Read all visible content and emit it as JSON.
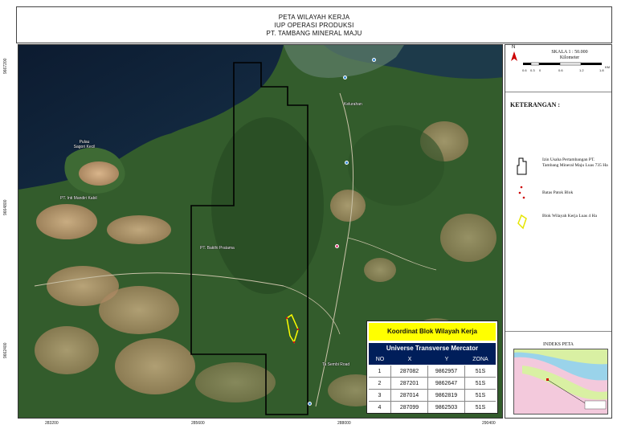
{
  "title": {
    "line1": "PETA WILAYAH KERJA",
    "line2": "IUP OPERASI PRODUKSI",
    "line3": "PT. TAMBANG MINERAL MAJU"
  },
  "axes": {
    "y_ticks": [
      "9667200",
      "9664800",
      "9662400"
    ],
    "x_ticks": [
      "283200",
      "285600",
      "288000",
      "290400"
    ]
  },
  "map_labels": {
    "pulau_sagori": "Pulau\nSagori Kecil",
    "pt_inti_mandiri": "PT. Inti Mandiri Kabil",
    "pt_bakti": "PT. Bakthi Pratama",
    "kelurahan": "Kelurahan",
    "ta_sembi": "Ta Sembi Road"
  },
  "scale": {
    "text": "SKALA 1 : 50.000",
    "unit": "Kilometer",
    "north": "N",
    "numbers": [
      "0.6",
      "0.3",
      "0",
      "0.6",
      "1.2",
      "1.8"
    ],
    "km": "KM"
  },
  "legend": {
    "title": "KETERANGAN :",
    "items": [
      {
        "label": "Izin Usaha Pertambangan PT. Tambang Mineral Maju Luas 735 Ha"
      },
      {
        "label": "Batas Patok Blok"
      },
      {
        "label": "Blok Wilayah Kerja Luas 4 Ha"
      }
    ]
  },
  "index_map": {
    "title": "INDEKS PETA"
  },
  "coord_table": {
    "title": "Koordinat Blok Wilayah Kerja",
    "subtitle": "Universe Transverse Mercator",
    "headers": [
      "NO",
      "X",
      "Y",
      "ZONA"
    ],
    "rows": [
      [
        "1",
        "287082",
        "9862957",
        "51S"
      ],
      [
        "2",
        "287201",
        "9862647",
        "51S"
      ],
      [
        "3",
        "287014",
        "9862819",
        "51S"
      ],
      [
        "4",
        "287099",
        "9862503",
        "51S"
      ]
    ]
  },
  "colors": {
    "sea": "#0e2138",
    "forest": "#2f5a2a",
    "bare_soil": "#c8a37a",
    "boundary": "#000000",
    "work_block": "#ffff00",
    "table_header": "#001e5a"
  }
}
